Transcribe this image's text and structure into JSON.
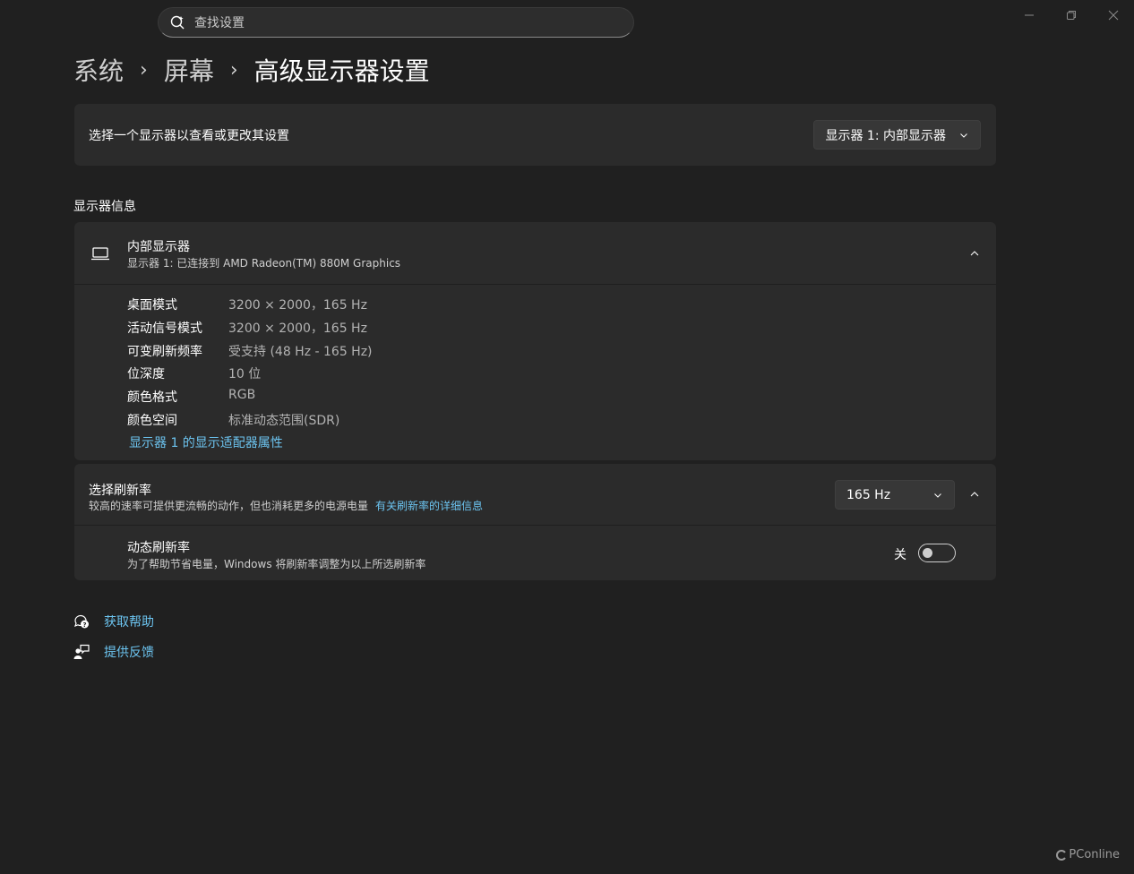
{
  "search": {
    "placeholder": "查找设置"
  },
  "window_controls": [
    "minimize-icon",
    "restore-icon",
    "close-icon"
  ],
  "breadcrumb": {
    "level1": "系统",
    "level2": "屏幕",
    "current": "高级显示器设置",
    "separator": "›"
  },
  "display_selector": {
    "label": "选择一个显示器以查看或更改其设置",
    "selected": "显示器 1: 内部显示器"
  },
  "display_info": {
    "section_title": "显示器信息",
    "name": "内部显示器",
    "subtitle": "显示器 1: 已连接到 AMD Radeon(TM) 880M Graphics",
    "rows": [
      {
        "key": "桌面模式",
        "value": "3200 × 2000，165 Hz"
      },
      {
        "key": "活动信号模式",
        "value": "3200 × 2000，165 Hz"
      },
      {
        "key": "可变刷新频率",
        "value": "受支持 (48 Hz - 165 Hz)"
      },
      {
        "key": "位深度",
        "value": "10 位"
      },
      {
        "key": "颜色格式",
        "value": "RGB"
      },
      {
        "key": "颜色空间",
        "value": "标准动态范围(SDR)"
      }
    ],
    "adapter_link": "显示器 1 的显示适配器属性"
  },
  "refresh_rate": {
    "title": "选择刷新率",
    "description": "较高的速率可提供更流畅的动作，但也消耗更多的电源电量",
    "details_link": "有关刷新率的详细信息",
    "selected": "165 Hz"
  },
  "dynamic_refresh": {
    "title": "动态刷新率",
    "description": "为了帮助节省电量，Windows 将刷新率调整为以上所选刷新率",
    "state_label": "关",
    "on": false
  },
  "help_links": {
    "get_help": "获取帮助",
    "feedback": "提供反馈"
  },
  "watermark": "PConline",
  "colors": {
    "background": "#202020",
    "card": "#2b2b2b",
    "link": "#6cc4f0"
  }
}
